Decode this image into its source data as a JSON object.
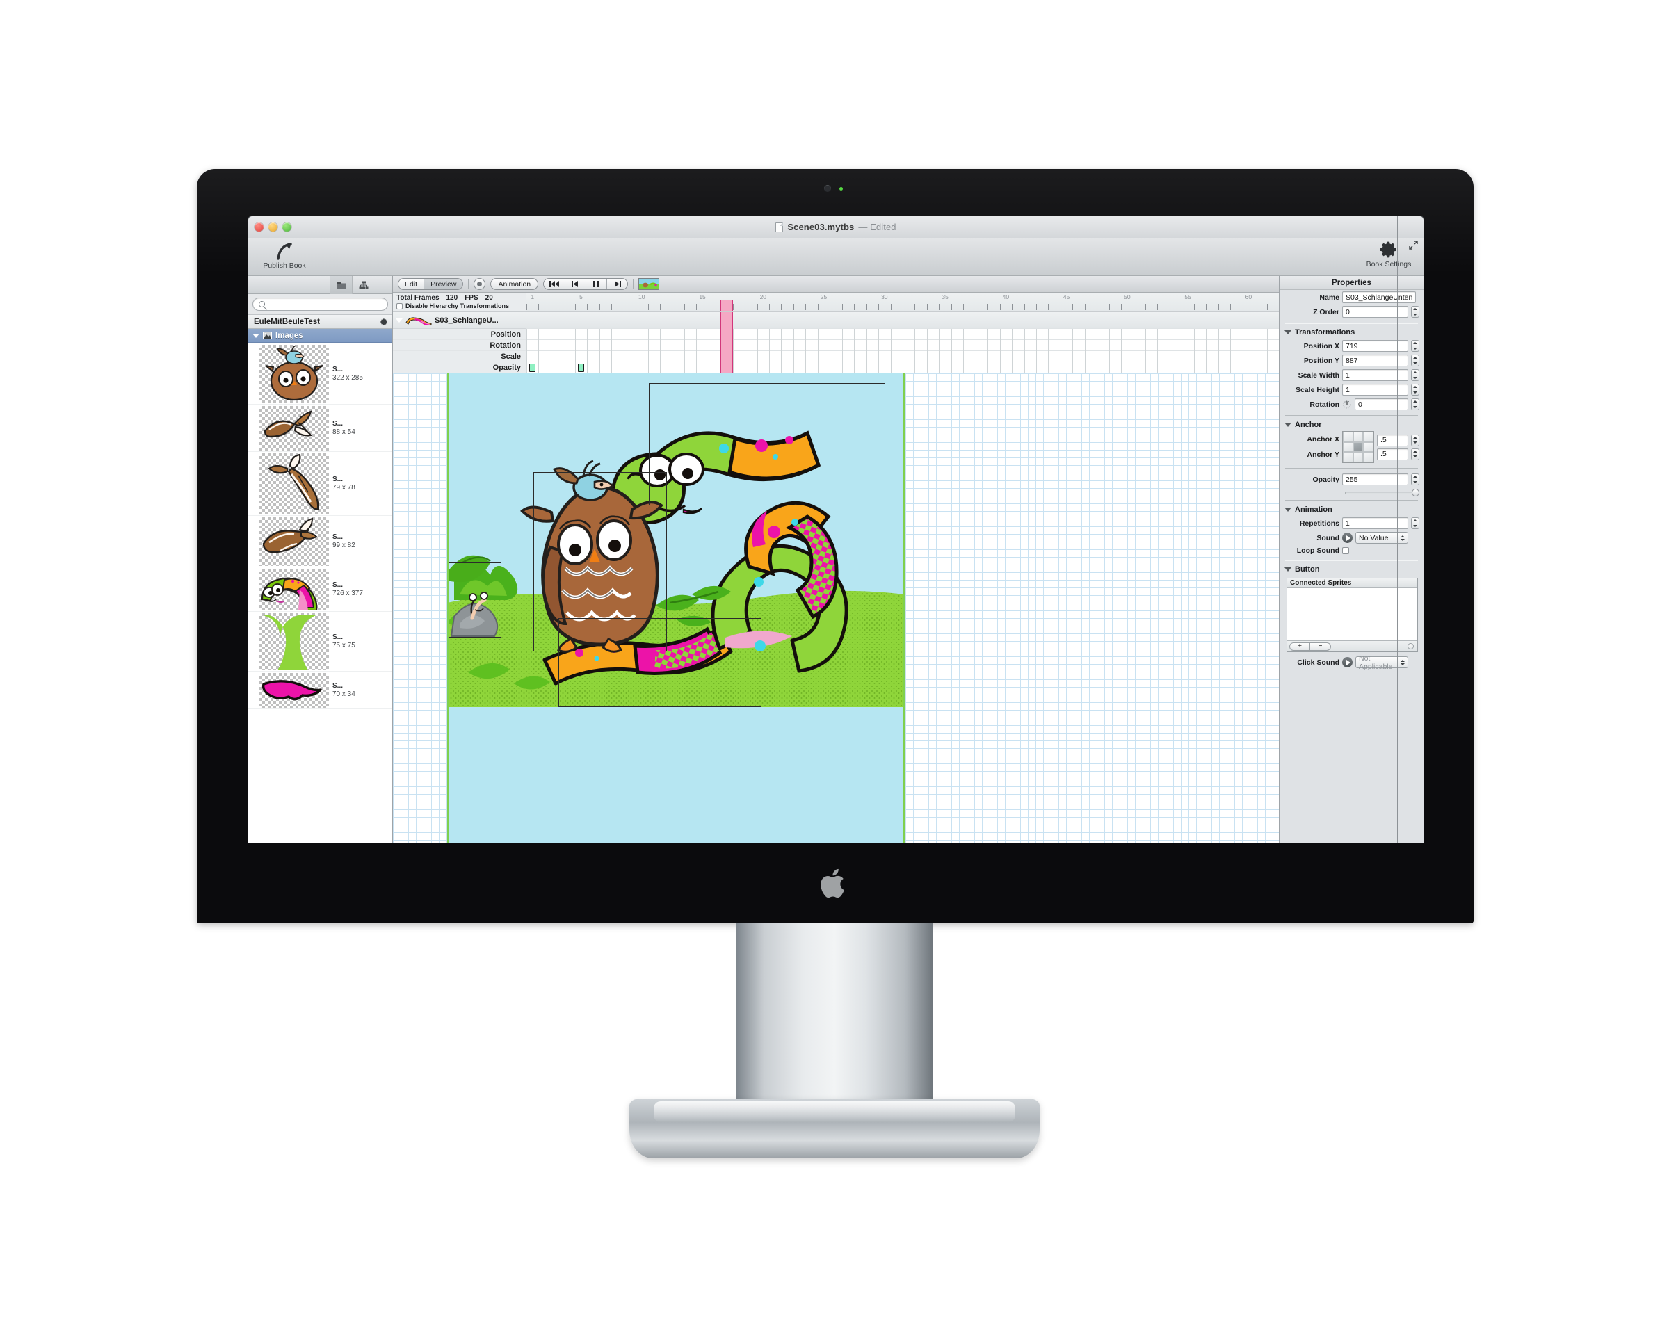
{
  "window": {
    "title": "Scene03.mytbs",
    "title_suffix": "— Edited",
    "traffic_lights": [
      "close-red",
      "minimize-yellow",
      "zoom-green"
    ]
  },
  "toolbar": {
    "publish_book_label": "Publish Book",
    "book_settings_label": "Book Settings",
    "fullscreen_icon": "fullscreen-icon"
  },
  "left_panel": {
    "tabs": [
      "assets-folder-icon",
      "hierarchy-icon"
    ],
    "search": {
      "value": "",
      "placeholder": ""
    },
    "project_name": "EuleMitBeuleTest",
    "group_label": "Images",
    "assets": [
      {
        "name": "S...",
        "dimensions": "322 x 285"
      },
      {
        "name": "S...",
        "dimensions": "88 x 54"
      },
      {
        "name": "S...",
        "dimensions": "79 x 78"
      },
      {
        "name": "S...",
        "dimensions": "99 x 82"
      },
      {
        "name": "S...",
        "dimensions": "726 x 377"
      },
      {
        "name": "S...",
        "dimensions": "75 x 75"
      },
      {
        "name": "S...",
        "dimensions": "70 x 34"
      }
    ]
  },
  "controls": {
    "mode_edit": "Edit",
    "mode_preview": "Preview",
    "record_icon": "record-icon",
    "animation_label": "Animation",
    "transport": [
      "⏮",
      "⏭",
      "⏸",
      "⏭"
    ]
  },
  "timeline": {
    "total_frames_label": "Total Frames",
    "total_frames_value": "120",
    "fps_label": "FPS",
    "fps_value": "20",
    "disable_hierarchy_label": "Disable Hierarchy Transformations",
    "disable_hierarchy_checked": false,
    "track_name": "S03_SchlangeU...",
    "property_rows": [
      "Position",
      "Rotation",
      "Scale",
      "Opacity"
    ],
    "ruler_marks": [
      1,
      5,
      10,
      15,
      20,
      25,
      30,
      35,
      40,
      45,
      50,
      55,
      60
    ],
    "playhead_frame": 17,
    "opacity_keyframes": [
      1,
      5
    ]
  },
  "properties": {
    "header": "Properties",
    "name_label": "Name",
    "name_value": "S03_SchlangeUnten",
    "zorder_label": "Z Order",
    "zorder_value": "0",
    "transformations": {
      "title": "Transformations",
      "position_x_label": "Position X",
      "position_x_value": "719",
      "position_y_label": "Position Y",
      "position_y_value": "887",
      "scale_width_label": "Scale Width",
      "scale_width_value": "1",
      "scale_height_label": "Scale Height",
      "scale_height_value": "1",
      "rotation_label": "Rotation",
      "rotation_value": "0",
      "rotation_icon": "rotation-dial-icon"
    },
    "anchor": {
      "title": "Anchor",
      "x_label": "Anchor X",
      "x_value": ".5",
      "y_label": "Anchor Y",
      "y_value": ".5"
    },
    "opacity": {
      "label": "Opacity",
      "value": "255",
      "slider_percent": 100
    },
    "animation": {
      "title": "Animation",
      "repetitions_label": "Repetitions",
      "repetitions_value": "1",
      "sound_label": "Sound",
      "sound_value": "No Value",
      "loop_sound_label": "Loop Sound",
      "loop_sound_checked": false
    },
    "button": {
      "title": "Button",
      "connected_sprites_header": "Connected Sprites",
      "connected_sprites": [],
      "add_label": "+",
      "remove_label": "−",
      "click_sound_label": "Click Sound",
      "click_sound_value": "Not Applicable"
    }
  },
  "colors": {
    "selection_blue": "#7e9ac3",
    "keyframe_green": "#8ff0c2",
    "playhead_pink": "#f5a8c4",
    "sky": "#b6e6f2",
    "grass": "#8fd53a",
    "snake_green": "#7ac70c",
    "snake_orange": "#f9a51a",
    "snake_magenta": "#ec13a8",
    "owl_brown": "#a8673a"
  },
  "canvas": {
    "scene_name": "Scene03",
    "selection_boxes": 4
  }
}
